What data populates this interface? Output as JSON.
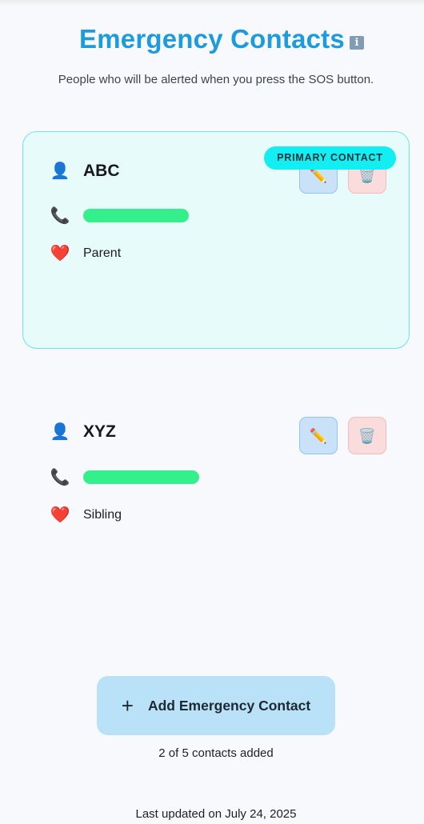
{
  "header": {
    "title": "Emergency Contacts",
    "info_icon_glyph": "i",
    "subtitle": "People who will be alerted when you press the SOS button."
  },
  "contacts": [
    {
      "name": "ABC",
      "relationship": "Parent",
      "badge": "PRIMARY CONTACT",
      "phone_redacted": true,
      "icons": {
        "person": "person-icon",
        "phone": "phone-icon",
        "relationship": "heart-icon",
        "edit": "pencil-icon",
        "delete": "trash-icon"
      }
    },
    {
      "name": "XYZ",
      "relationship": "Sibling",
      "phone_redacted": true,
      "icons": {
        "person": "person-icon",
        "phone": "phone-icon",
        "relationship": "heart-icon",
        "edit": "pencil-icon",
        "delete": "trash-icon"
      }
    }
  ],
  "actions": {
    "add_label": "Add Emergency Contact",
    "add_icon": "plus-icon"
  },
  "footer": {
    "count_text": "2 of 5 contacts added",
    "updated_text": "Last updated on July 24, 2025"
  },
  "colors": {
    "accent": "#1e9bdc",
    "primary_card_bg": "#e7fbfb",
    "primary_badge": "#12eef2",
    "redaction": "#33f08c",
    "add_button": "#b9e2f9"
  }
}
